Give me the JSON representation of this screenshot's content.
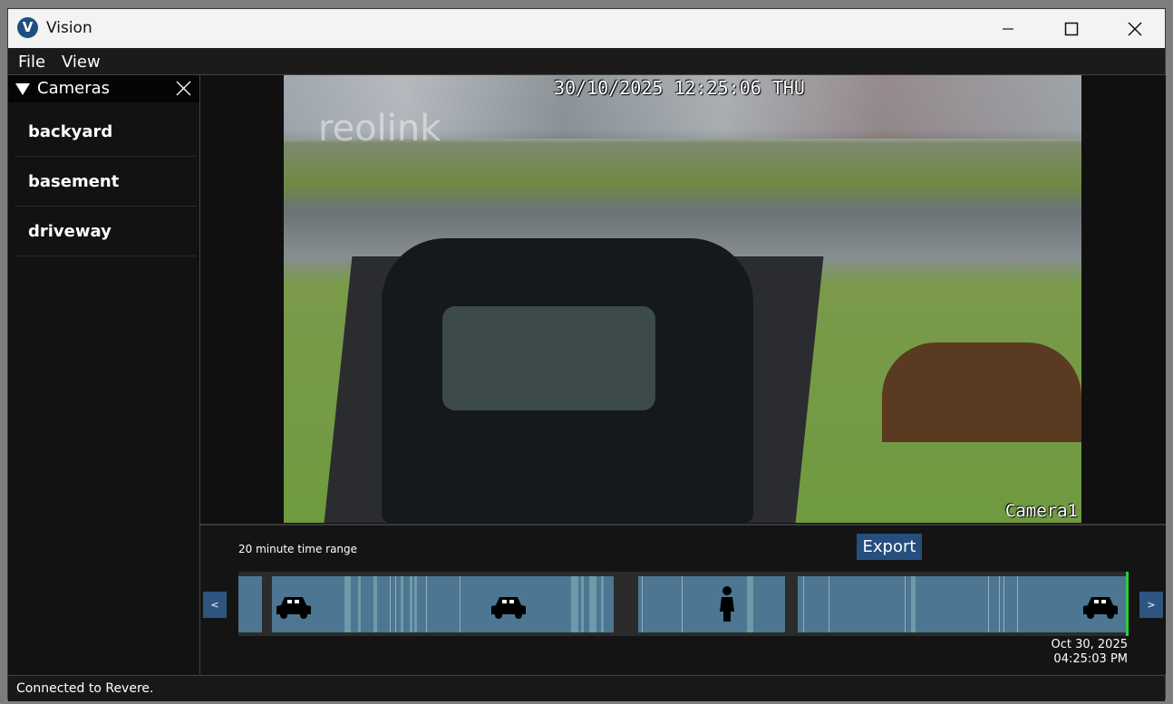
{
  "window": {
    "title": "Vision"
  },
  "menu": {
    "file": "File",
    "view": "View"
  },
  "sidebar": {
    "title": "Cameras",
    "items": [
      {
        "label": "backyard"
      },
      {
        "label": "basement"
      },
      {
        "label": "driveway"
      }
    ]
  },
  "video": {
    "timestamp": "30/10/2025 12:25:06 THU",
    "camera_label": "Camera1",
    "watermark": "reolink"
  },
  "timeline": {
    "range_label": "20 minute time range",
    "export_label": "Export",
    "prev_label": "<",
    "next_label": ">",
    "end_date": "Oct 30, 2025",
    "end_time": "04:25:03 PM",
    "events": [
      "car-icon",
      "car-icon",
      "person-icon",
      "car-icon"
    ],
    "colors": {
      "segment": "#4c7691",
      "now_marker": "#2ecc40",
      "button": "#2e5580"
    }
  },
  "status": {
    "text": "Connected to Revere."
  }
}
